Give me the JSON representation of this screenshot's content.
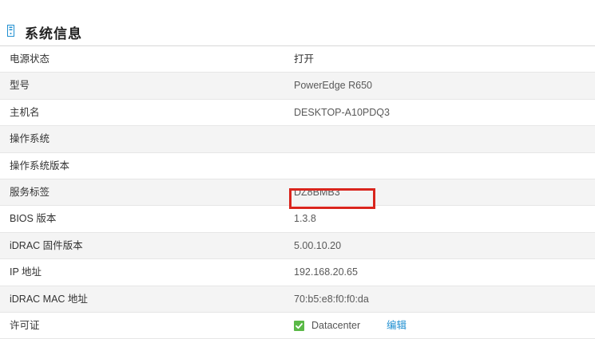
{
  "section": {
    "title": "系统信息",
    "icon": "server-icon"
  },
  "rows": [
    {
      "label": "电源状态",
      "value": "打开"
    },
    {
      "label": "型号",
      "value": "PowerEdge R650"
    },
    {
      "label": "主机名",
      "value": "DESKTOP-A10PDQ3"
    },
    {
      "label": "操作系统",
      "value": ""
    },
    {
      "label": "操作系统版本",
      "value": ""
    },
    {
      "label": "服务标签",
      "value": "DZ8BMB3"
    },
    {
      "label": "BIOS 版本",
      "value": "1.3.8"
    },
    {
      "label": "iDRAC 固件版本",
      "value": "5.00.10.20"
    },
    {
      "label": "IP 地址",
      "value": "192.168.20.65"
    },
    {
      "label": "iDRAC MAC 地址",
      "value": "70:b5:e8:f0:f0:da"
    },
    {
      "label": "许可证",
      "value": "Datacenter",
      "action": "编辑",
      "checked": true
    }
  ],
  "colors": {
    "highlight": "#d9251d",
    "check": "#5ab947",
    "link": "#1f8fd1"
  }
}
